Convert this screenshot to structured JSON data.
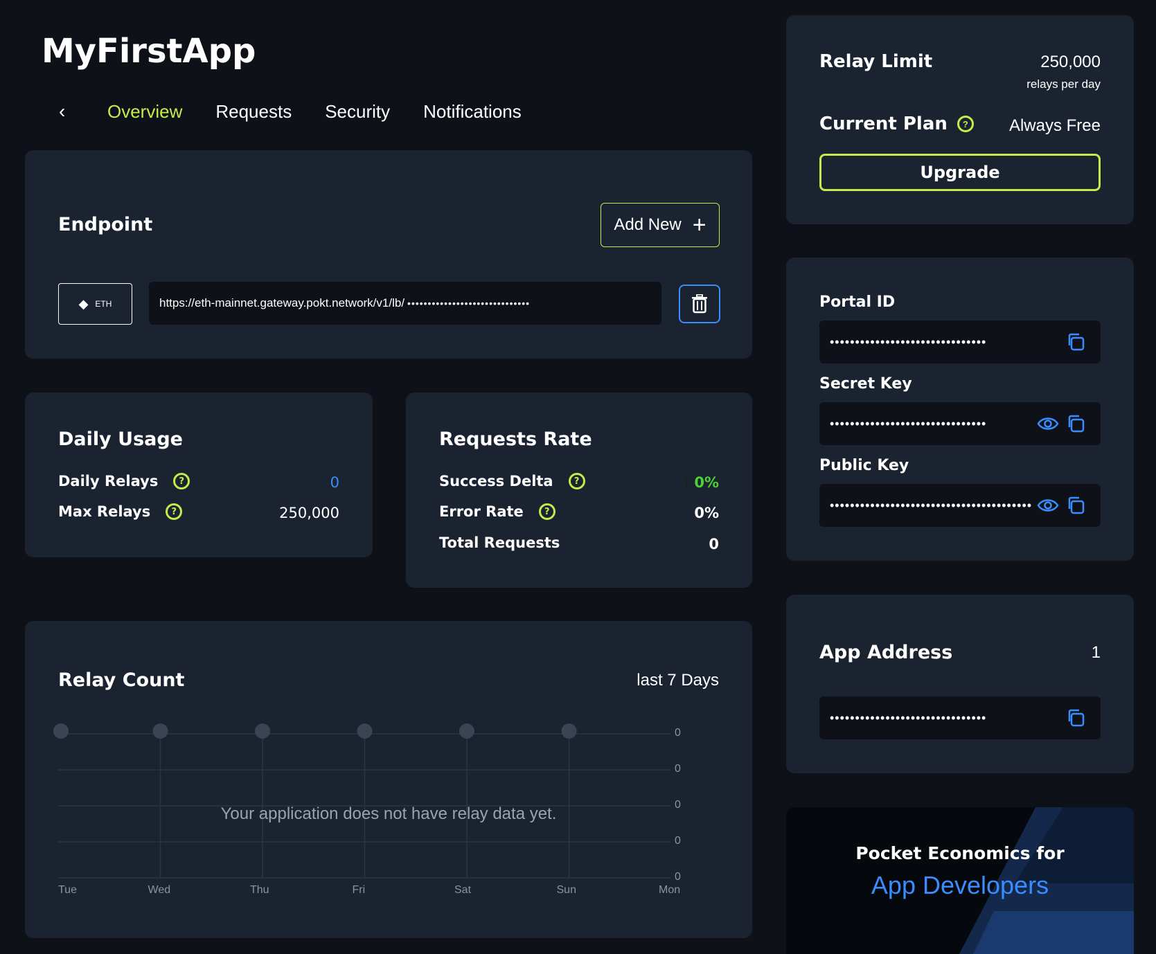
{
  "app": {
    "title": "MyFirstApp"
  },
  "tabs": {
    "back": "‹",
    "items": [
      "Overview",
      "Requests",
      "Security",
      "Notifications"
    ]
  },
  "endpoint": {
    "title": "Endpoint",
    "add_new": "Add New",
    "chain": "ETH",
    "url": "https://eth-mainnet.gateway.pokt.network/v1/lb/",
    "url_mask": "••••••••••••••••••••••••••••••"
  },
  "daily_usage": {
    "title": "Daily Usage",
    "daily_relays_label": "Daily Relays",
    "daily_relays_value": "0",
    "max_relays_label": "Max Relays",
    "max_relays_value": "250,000"
  },
  "requests_rate": {
    "title": "Requests Rate",
    "success_delta_label": "Success Delta",
    "success_delta_value": "0%",
    "error_rate_label": "Error Rate",
    "error_rate_value": "0%",
    "total_requests_label": "Total Requests",
    "total_requests_value": "0"
  },
  "relay_count": {
    "title": "Relay Count",
    "range": "last 7 Days",
    "empty_message": "Your application does not have relay data yet.",
    "days": [
      "Tue",
      "Wed",
      "Thu",
      "Fri",
      "Sat",
      "Sun",
      "Mon"
    ],
    "y_ticks": [
      "0",
      "0",
      "0",
      "0",
      "0"
    ]
  },
  "plan": {
    "relay_limit_label": "Relay Limit",
    "relay_limit_value": "250,000",
    "relay_limit_unit": "relays per day",
    "current_plan_label": "Current Plan",
    "current_plan_value": "Always Free",
    "upgrade": "Upgrade"
  },
  "keys": {
    "portal_id_label": "Portal ID",
    "portal_id_mask": "•••••••••••••••••••••••••••••••",
    "secret_key_label": "Secret Key",
    "secret_key_mask": "•••••••••••••••••••••••••••••••",
    "public_key_label": "Public Key",
    "public_key_mask": "••••••••••••••••••••••••••••••••••••••••"
  },
  "app_address": {
    "title": "App Address",
    "count": "1",
    "mask": "•••••••••••••••••••••••••••••••"
  },
  "promo": {
    "line1": "Pocket Economics for",
    "line2": "App Developers"
  },
  "colors": {
    "accent": "#c5ec4b",
    "blue": "#3a8dff",
    "success": "#4cd137",
    "card": "#1b2330",
    "bg": "#0e1218"
  }
}
